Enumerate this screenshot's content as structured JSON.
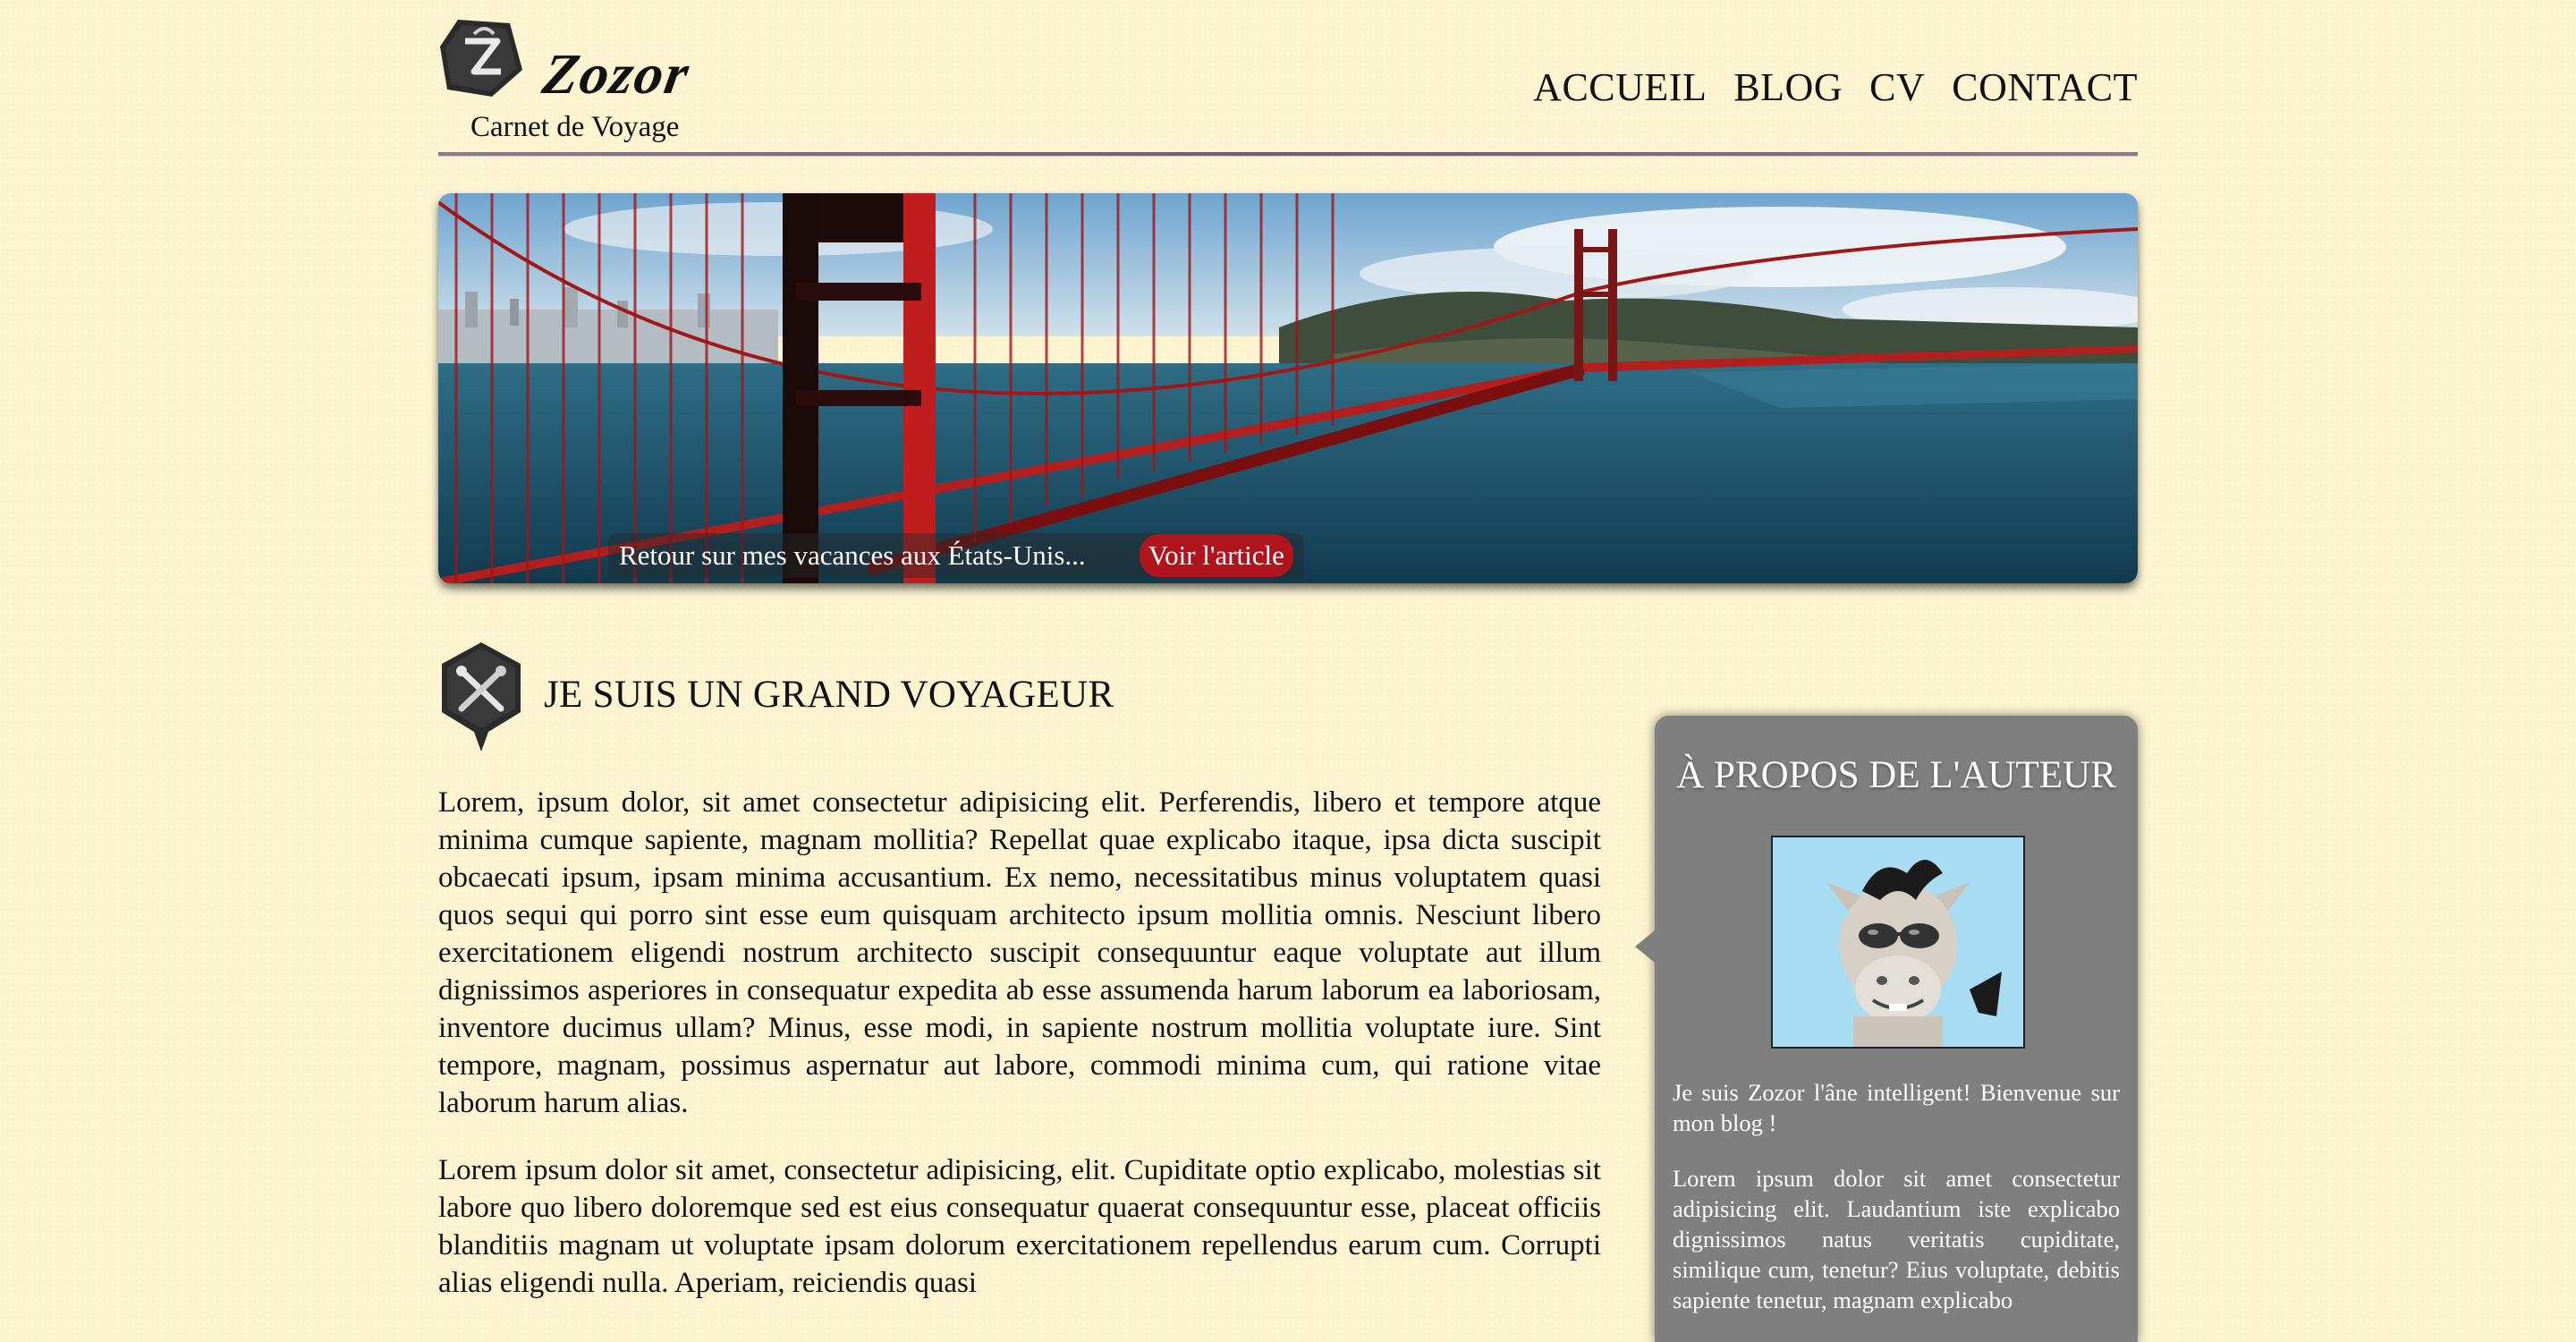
{
  "header": {
    "site_name": "Zozor",
    "tagline": "Carnet de Voyage",
    "nav": [
      "ACCUEIL",
      "BLOG",
      "CV",
      "CONTACT"
    ]
  },
  "banner": {
    "caption": "Retour sur mes vacances aux États-Unis...",
    "button_label": "Voir l'article"
  },
  "article": {
    "title": "JE SUIS UN GRAND VOYAGEUR",
    "paragraphs": [
      "Lorem, ipsum dolor, sit amet consectetur adipisicing elit. Perferendis, libero et tempore atque minima cumque sapiente, magnam mollitia? Repellat quae explicabo itaque, ipsa dicta suscipit obcaecati ipsum, ipsam minima accusantium. Ex nemo, necessitatibus minus voluptatem quasi quos sequi qui porro sint esse eum quisquam architecto ipsum mollitia omnis. Nesciunt libero exercitationem eligendi nostrum architecto suscipit consequuntur eaque voluptate aut illum dignissimos asperiores in consequatur expedita ab esse assumenda harum laborum ea laboriosam, inventore ducimus ullam? Minus, esse modi, in sapiente nostrum mollitia voluptate iure. Sint tempore, magnam, possimus aspernatur aut labore, commodi minima cum, qui ratione vitae laborum harum alias.",
      "Lorem ipsum dolor sit amet, consectetur adipisicing, elit. Cupiditate optio explicabo, molestias sit labore quo libero doloremque sed est eius consequatur quaerat consequuntur esse, placeat officiis blanditiis magnam ut voluptate ipsam dolorum exercitationem repellendus earum cum. Corrupti alias eligendi nulla. Aperiam, reiciendis quasi"
    ]
  },
  "aside": {
    "title": "À PROPOS DE L'AUTEUR",
    "paragraphs": [
      "Je suis Zozor l'âne intelligent! Bienvenue sur mon blog !",
      "Lorem ipsum dolor sit amet consectetur adipisicing elit. Laudantium iste explicabo dignissimos natus veritatis cupiditate, similique cum, tenetur? Eius voluptate, debitis sapiente tenetur, magnam explicabo"
    ]
  },
  "colors": {
    "background": "#fdf4d2",
    "accent_red": "#b0141c",
    "aside_gray": "#7f7f7f"
  }
}
